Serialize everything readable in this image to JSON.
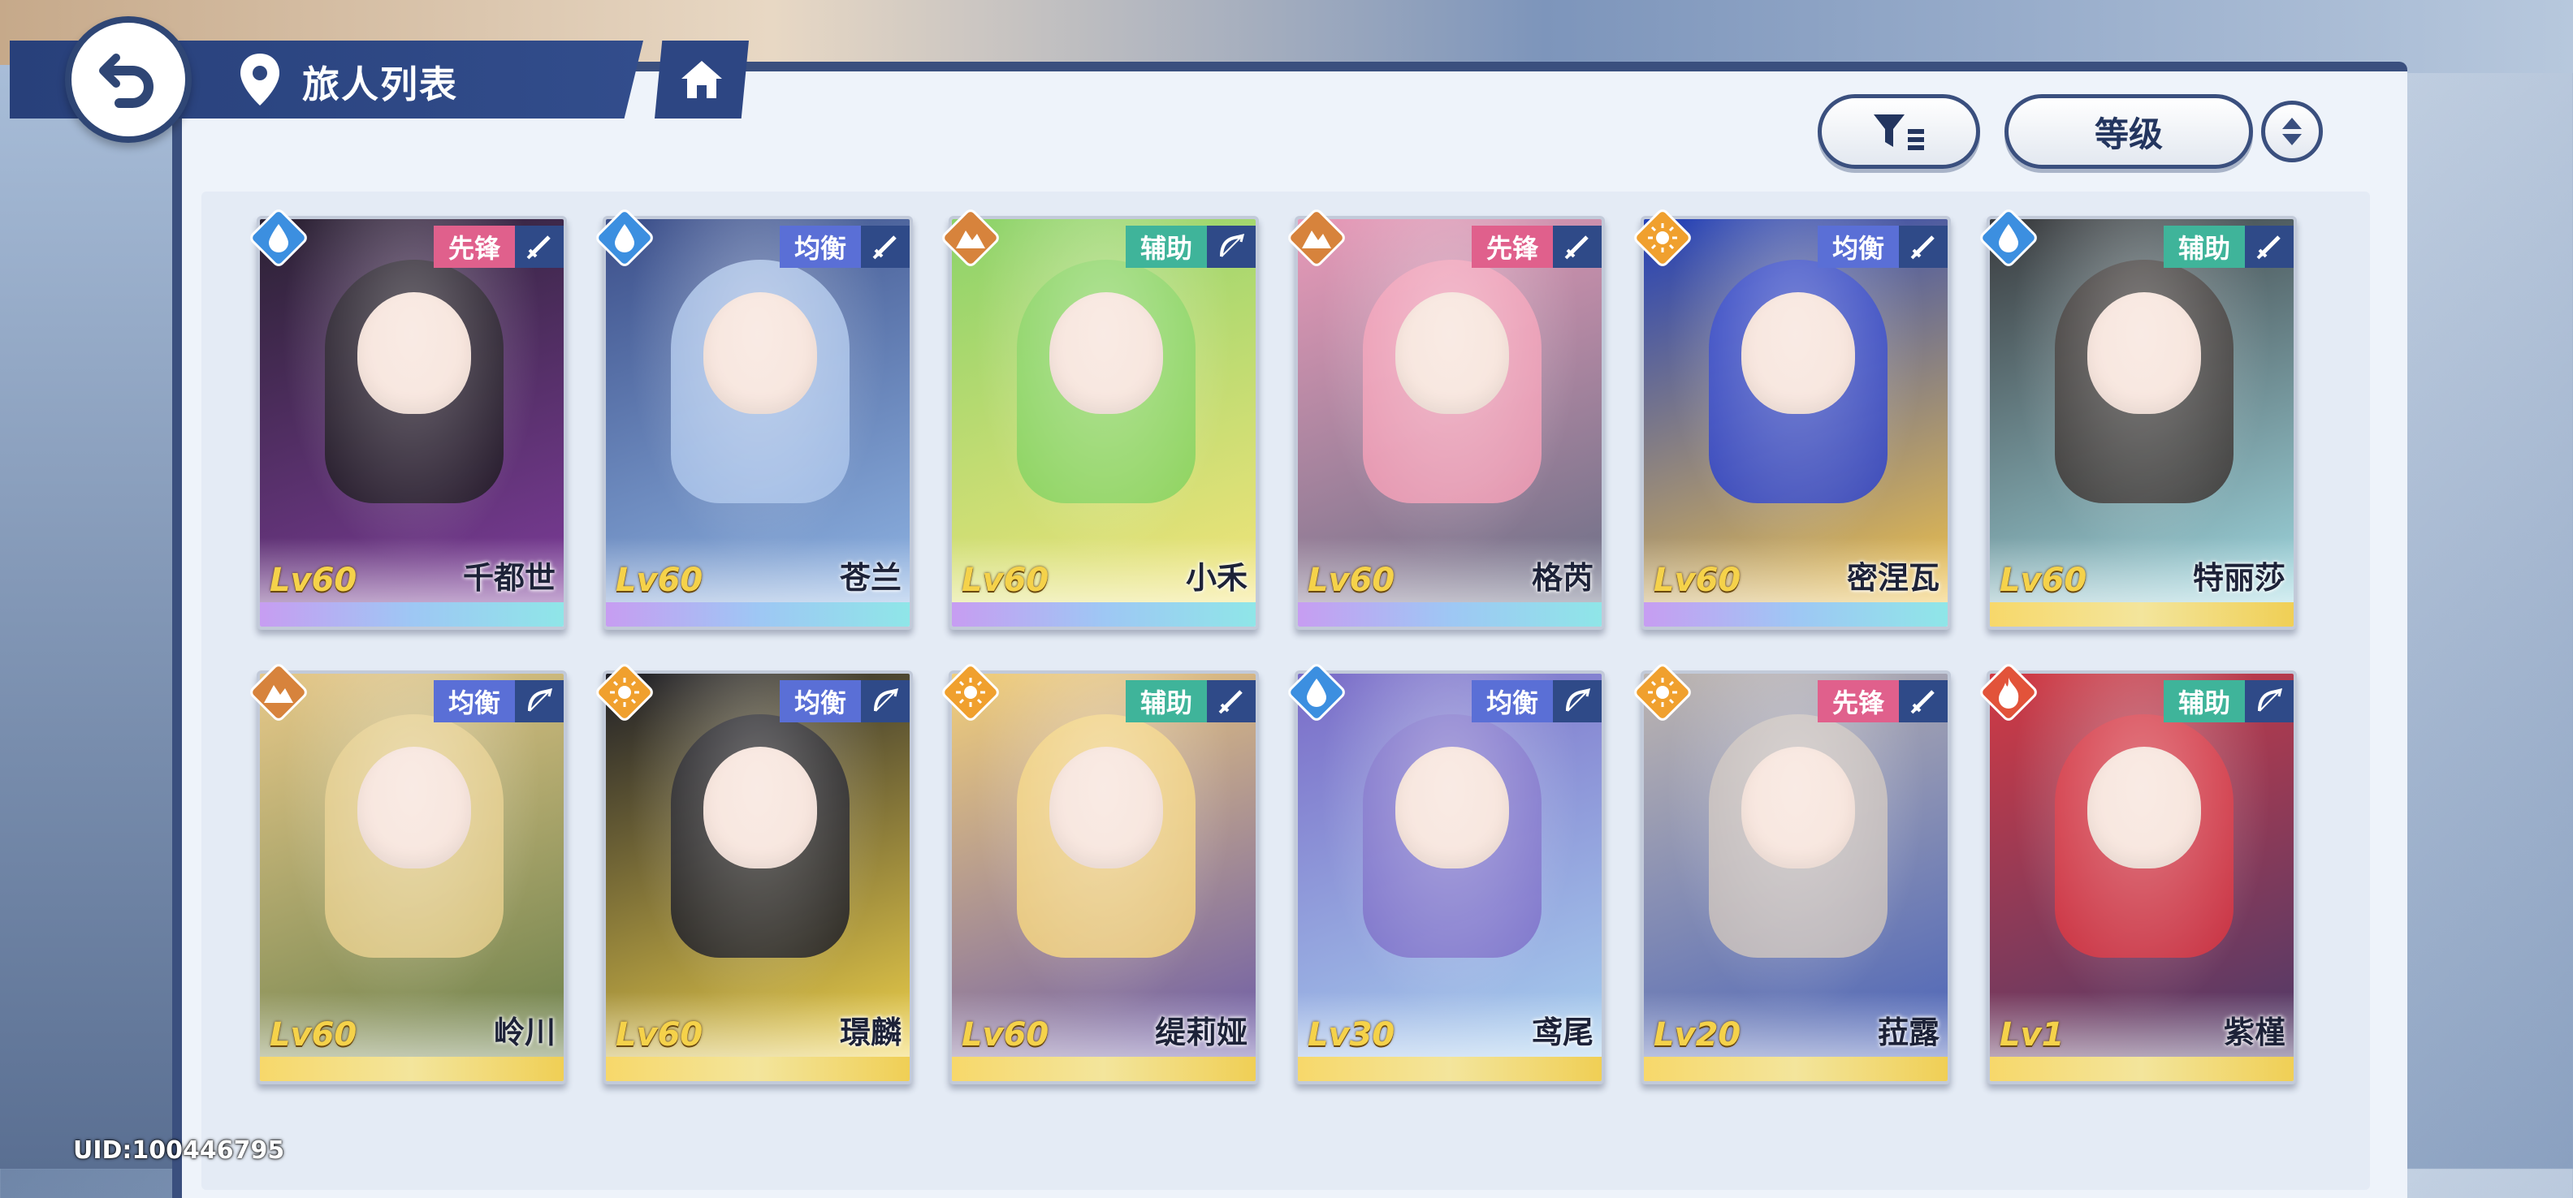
{
  "header": {
    "title": "旅人列表",
    "sort_label": "等级"
  },
  "footer": {
    "uid": "UID:100446795"
  },
  "colors": {
    "role_vanguard": "#e0608c",
    "role_balanced": "#5a6fd6",
    "role_support": "#3fb49a",
    "elem_water": "#3c8fe0",
    "elem_earth": "#d7833c",
    "elem_light": "#f0a02e",
    "elem_fire": "#e2533a"
  },
  "cards": [
    {
      "name": "千都世",
      "level": "Lv60",
      "role": "先锋",
      "element": "water",
      "weapon": "sword",
      "rarity": "purple"
    },
    {
      "name": "苍兰",
      "level": "Lv60",
      "role": "均衡",
      "element": "water",
      "weapon": "sword",
      "rarity": "purple"
    },
    {
      "name": "小禾",
      "level": "Lv60",
      "role": "辅助",
      "element": "earth",
      "weapon": "bow",
      "rarity": "purple"
    },
    {
      "name": "格芮",
      "level": "Lv60",
      "role": "先锋",
      "element": "earth",
      "weapon": "sword",
      "rarity": "purple"
    },
    {
      "name": "密涅瓦",
      "level": "Lv60",
      "role": "均衡",
      "element": "light",
      "weapon": "sword",
      "rarity": "purple"
    },
    {
      "name": "特丽莎",
      "level": "Lv60",
      "role": "辅助",
      "element": "water",
      "weapon": "sword",
      "rarity": "gold"
    },
    {
      "name": "岭川",
      "level": "Lv60",
      "role": "均衡",
      "element": "earth",
      "weapon": "bow",
      "rarity": "gold"
    },
    {
      "name": "璟麟",
      "level": "Lv60",
      "role": "均衡",
      "element": "light",
      "weapon": "bow",
      "rarity": "gold"
    },
    {
      "name": "缇莉娅",
      "level": "Lv60",
      "role": "辅助",
      "element": "light",
      "weapon": "sword",
      "rarity": "gold"
    },
    {
      "name": "鸢尾",
      "level": "Lv30",
      "role": "均衡",
      "element": "water",
      "weapon": "bow",
      "rarity": "gold"
    },
    {
      "name": "菈露",
      "level": "Lv20",
      "role": "先锋",
      "element": "light",
      "weapon": "sword",
      "rarity": "gold"
    },
    {
      "name": "紫槿",
      "level": "Lv1",
      "role": "辅助",
      "element": "fire",
      "weapon": "bow",
      "rarity": "gold"
    }
  ]
}
